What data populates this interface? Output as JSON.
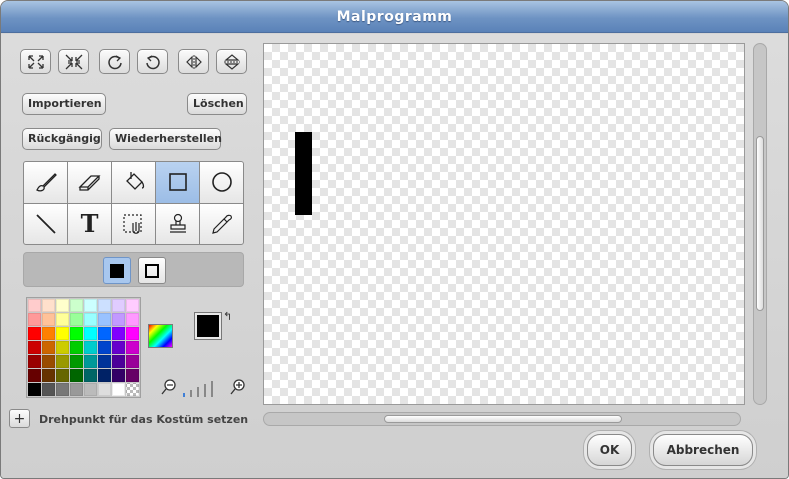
{
  "window": {
    "title": "Malprogramm"
  },
  "transform_buttons": [
    {
      "name": "grow-icon"
    },
    {
      "name": "shrink-icon"
    },
    {
      "name": "rotate-right-icon"
    },
    {
      "name": "rotate-left-icon"
    },
    {
      "name": "flip-horizontal-icon"
    },
    {
      "name": "flip-vertical-icon"
    }
  ],
  "actions": {
    "import_label": "Importieren",
    "clear_label": "Löschen",
    "undo_label": "Rückgängig",
    "redo_label": "Wiederherstellen"
  },
  "tools": [
    {
      "name": "paintbrush-icon",
      "selected": false
    },
    {
      "name": "eraser-icon",
      "selected": false
    },
    {
      "name": "fill-bucket-icon",
      "selected": false
    },
    {
      "name": "rectangle-icon",
      "selected": true
    },
    {
      "name": "ellipse-icon",
      "selected": false
    },
    {
      "name": "line-icon",
      "selected": false
    },
    {
      "name": "text-icon",
      "selected": false
    },
    {
      "name": "select-icon",
      "selected": false
    },
    {
      "name": "stamp-icon",
      "selected": false
    },
    {
      "name": "eyedropper-icon",
      "selected": false
    }
  ],
  "text_tool_glyph": "T",
  "shape_options": {
    "filled_selected": true
  },
  "palette": [
    "#ffcccc",
    "#ffe0cc",
    "#ffffcc",
    "#ccffcc",
    "#ccffff",
    "#cce0ff",
    "#e0ccff",
    "#ffccff",
    "#ff9999",
    "#ffc299",
    "#ffff99",
    "#99ff99",
    "#99ffff",
    "#99c2ff",
    "#c299ff",
    "#ff99ff",
    "#ff0000",
    "#ff8000",
    "#ffff00",
    "#00ff00",
    "#00ffff",
    "#0066ff",
    "#8000ff",
    "#ff00ff",
    "#cc0000",
    "#cc6600",
    "#cccc00",
    "#00cc00",
    "#00cccc",
    "#0044cc",
    "#6600cc",
    "#cc00cc",
    "#990000",
    "#994c00",
    "#999900",
    "#009900",
    "#009999",
    "#003399",
    "#4c0099",
    "#990099",
    "#660000",
    "#663300",
    "#666600",
    "#006600",
    "#006666",
    "#002266",
    "#330066",
    "#660066",
    "#000000",
    "#555555",
    "#777777",
    "#999999",
    "#bbbbbb",
    "#dddddd",
    "#ffffff",
    "#ffffff"
  ],
  "colors": {
    "foreground": "#000000",
    "background": "#ffffff",
    "swap_glyph": "↰"
  },
  "pivot": {
    "label": "Drehpunkt für das Kostüm setzen",
    "glyph": "+"
  },
  "dialog": {
    "ok_label": "OK",
    "cancel_label": "Abbrechen"
  }
}
